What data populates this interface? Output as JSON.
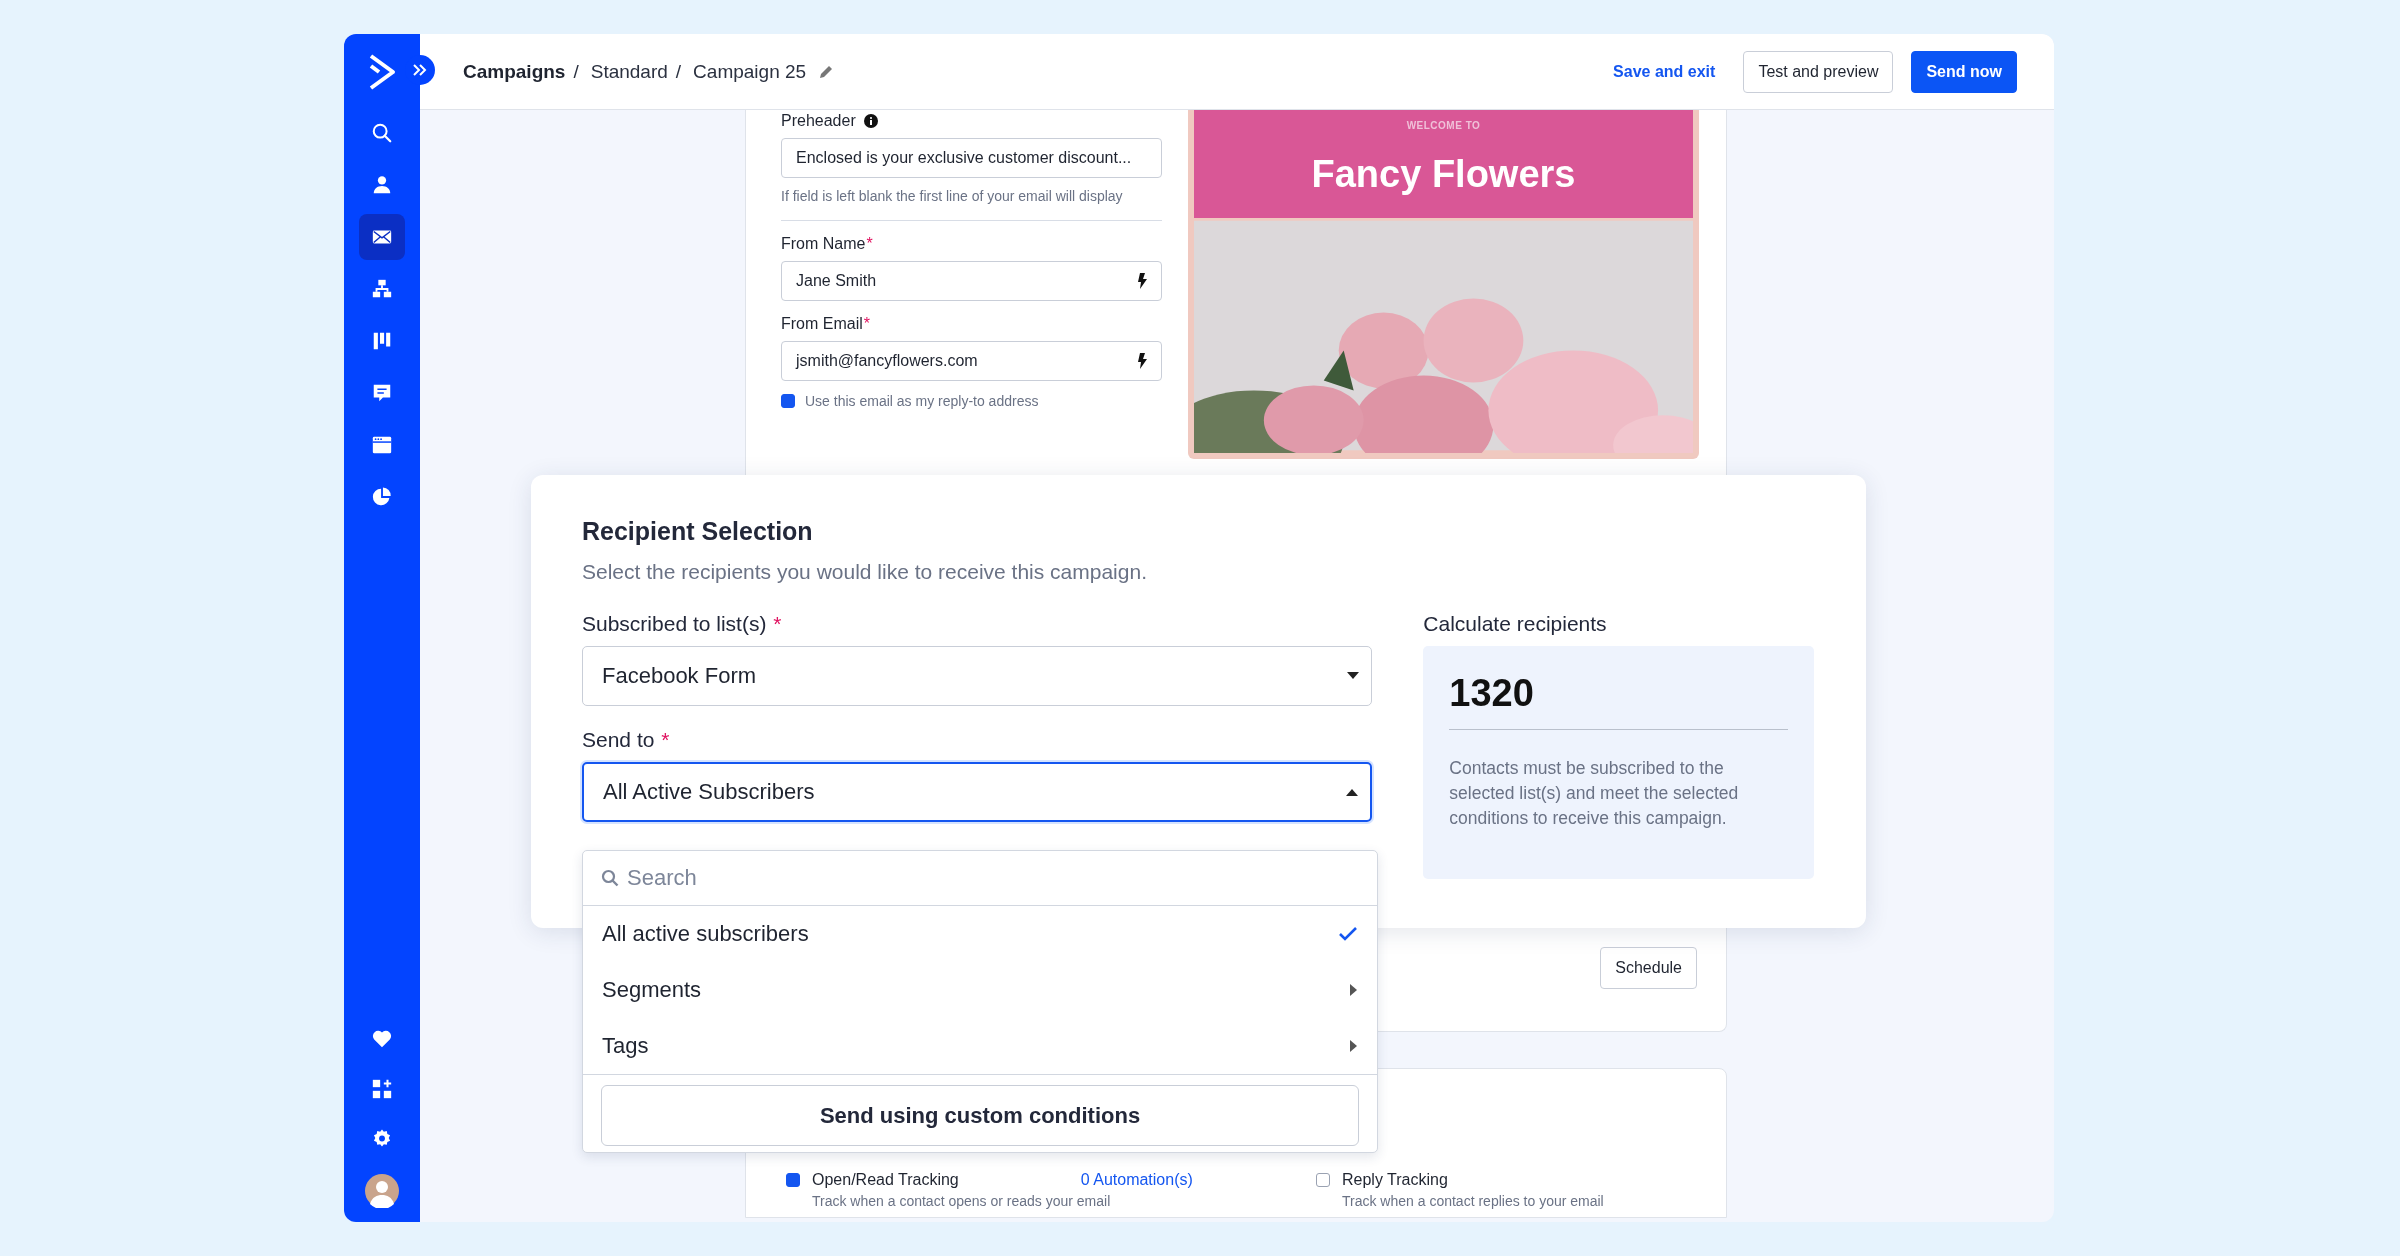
{
  "sidebar": {
    "items": [
      {
        "kind": "search",
        "selected": false
      },
      {
        "kind": "person",
        "selected": false
      },
      {
        "kind": "envelope",
        "selected": true
      },
      {
        "kind": "hierarchy",
        "selected": false
      },
      {
        "kind": "columns",
        "selected": false
      },
      {
        "kind": "chat",
        "selected": false
      },
      {
        "kind": "browser",
        "selected": false
      },
      {
        "kind": "pie",
        "selected": false
      }
    ],
    "bottom_items": [
      {
        "kind": "heart"
      },
      {
        "kind": "grid"
      },
      {
        "kind": "gear"
      },
      {
        "kind": "avatar"
      }
    ]
  },
  "header": {
    "breadcrumbs": [
      {
        "label": "Campaigns",
        "kind": "root"
      },
      {
        "label": "Standard",
        "kind": "link"
      },
      {
        "label": "Campaign 25",
        "kind": "current"
      }
    ],
    "separator": "/",
    "save_link": "Save and exit",
    "buttons": [
      {
        "label": "Test and preview",
        "kind": "secondary"
      },
      {
        "label": "Send now",
        "kind": "primary"
      }
    ]
  },
  "form": {
    "preheader": {
      "label": "Preheader",
      "value": "Enclosed is your exclusive customer discount...",
      "hint": "If field is left blank the first line of your email will display"
    },
    "fields": [
      {
        "label": "From Name",
        "required_mark": "*",
        "value": "Jane Smith"
      },
      {
        "label": "From Email",
        "required_mark": "*",
        "value": "jsmith@fancyflowers.com"
      }
    ],
    "reply_to": {
      "label": "Use this email as my reply-to address",
      "checked": true
    }
  },
  "preview": {
    "eyebrow": "WELCOME TO",
    "title": "Fancy Flowers"
  },
  "schedule_button": "Schedule",
  "tracking": [
    {
      "label": "Open/Read Tracking",
      "checked": true,
      "hint": "Track when a contact opens or reads your email",
      "link": "0 Automation(s)"
    },
    {
      "label": "Reply Tracking",
      "checked": false,
      "hint": "Track when a contact replies to your email"
    }
  ],
  "recipient_selection": {
    "title": "Recipient Selection",
    "subtitle": "Select the recipients you would like to receive this campaign.",
    "list_field": {
      "label": "Subscribed to list(s)",
      "required_mark": "*",
      "value": "Facebook Form",
      "open": false
    },
    "send_to": {
      "label": "Send to",
      "required_mark": "*",
      "value": "All Active Subscribers",
      "open": true
    },
    "dropdown": {
      "placeholder": "Search",
      "options": [
        {
          "label": "All active subscribers",
          "kind": "option",
          "selected": true
        },
        {
          "label": "Segments",
          "kind": "submenu",
          "selected": false
        },
        {
          "label": "Tags",
          "kind": "submenu",
          "selected": false
        }
      ],
      "footer_button": "Send using custom conditions"
    },
    "calculate": {
      "title": "Calculate recipients",
      "count": "1320",
      "note": "Contacts must be subscribed to the selected list(s) and meet the selected conditions to receive this campaign."
    }
  }
}
